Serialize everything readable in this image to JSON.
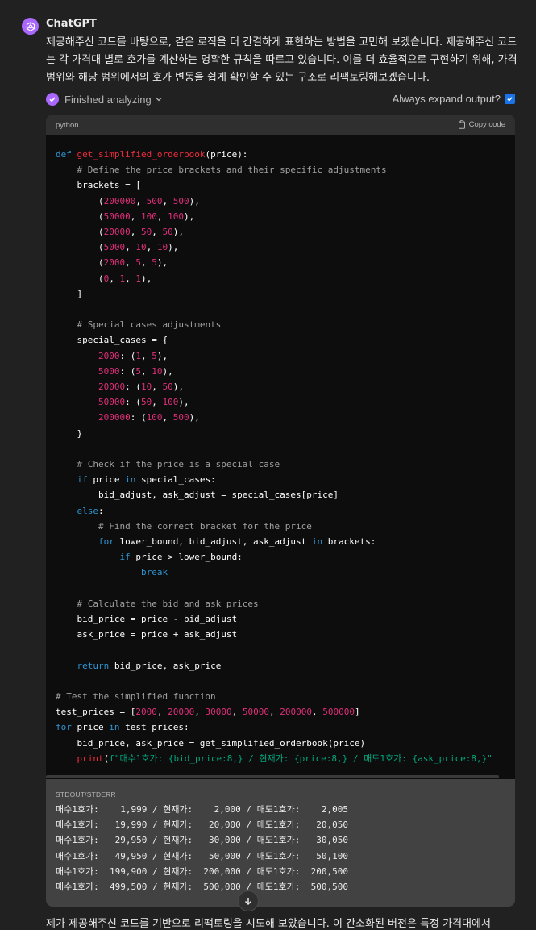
{
  "message": {
    "author": "ChatGPT",
    "intro": "제공해주신 코드를 바탕으로, 같은 로직을 더 간결하게 표현하는 방법을 고민해 보겠습니다. 제공해주신 코드는 각 가격대 별로 호가를 계산하는 명확한 규칙을 따르고 있습니다. 이를 더 효율적으로 구현하기 위해, 가격 범위와 해당 범위에서의 호가 변동을 쉽게 확인할 수 있는 구조로 리팩토링해보겠습니다.",
    "tail": "제가 제공해주신 코드를 기반으로 리팩토링을 시도해 보았습니다. 이 간소화된 버전은 특정 가격대에서"
  },
  "analysis": {
    "status": "Finished analyzing",
    "expand_label": "Always expand output?"
  },
  "code_block": {
    "language": "python",
    "copy_label": "Copy code",
    "lines": [
      {
        "t": [
          [
            "kw",
            "def "
          ],
          [
            "fn",
            "get_simplified_orderbook"
          ],
          [
            "",
            "(price):"
          ]
        ]
      },
      {
        "t": [
          [
            "",
            "    "
          ],
          [
            "cm",
            "# Define the price brackets and their specific adjustments"
          ]
        ]
      },
      {
        "t": [
          [
            "",
            "    brackets = ["
          ]
        ]
      },
      {
        "t": [
          [
            "",
            "        ("
          ],
          [
            "num",
            "200000"
          ],
          [
            "",
            ", "
          ],
          [
            "num",
            "500"
          ],
          [
            "",
            ", "
          ],
          [
            "num",
            "500"
          ],
          [
            "",
            "),"
          ]
        ]
      },
      {
        "t": [
          [
            "",
            "        ("
          ],
          [
            "num",
            "50000"
          ],
          [
            "",
            ", "
          ],
          [
            "num",
            "100"
          ],
          [
            "",
            ", "
          ],
          [
            "num",
            "100"
          ],
          [
            "",
            "),"
          ]
        ]
      },
      {
        "t": [
          [
            "",
            "        ("
          ],
          [
            "num",
            "20000"
          ],
          [
            "",
            ", "
          ],
          [
            "num",
            "50"
          ],
          [
            "",
            ", "
          ],
          [
            "num",
            "50"
          ],
          [
            "",
            "),"
          ]
        ]
      },
      {
        "t": [
          [
            "",
            "        ("
          ],
          [
            "num",
            "5000"
          ],
          [
            "",
            ", "
          ],
          [
            "num",
            "10"
          ],
          [
            "",
            ", "
          ],
          [
            "num",
            "10"
          ],
          [
            "",
            "),"
          ]
        ]
      },
      {
        "t": [
          [
            "",
            "        ("
          ],
          [
            "num",
            "2000"
          ],
          [
            "",
            ", "
          ],
          [
            "num",
            "5"
          ],
          [
            "",
            ", "
          ],
          [
            "num",
            "5"
          ],
          [
            "",
            "),"
          ]
        ]
      },
      {
        "t": [
          [
            "",
            "        ("
          ],
          [
            "num",
            "0"
          ],
          [
            "",
            ", "
          ],
          [
            "num",
            "1"
          ],
          [
            "",
            ", "
          ],
          [
            "num",
            "1"
          ],
          [
            "",
            "),"
          ]
        ]
      },
      {
        "t": [
          [
            "",
            "    ]"
          ]
        ]
      },
      {
        "t": []
      },
      {
        "t": [
          [
            "",
            "    "
          ],
          [
            "cm",
            "# Special cases adjustments"
          ]
        ]
      },
      {
        "t": [
          [
            "",
            "    special_cases = {"
          ]
        ]
      },
      {
        "t": [
          [
            "",
            "        "
          ],
          [
            "num",
            "2000"
          ],
          [
            "",
            ": ("
          ],
          [
            "num",
            "1"
          ],
          [
            "",
            ", "
          ],
          [
            "num",
            "5"
          ],
          [
            "",
            "),"
          ]
        ]
      },
      {
        "t": [
          [
            "",
            "        "
          ],
          [
            "num",
            "5000"
          ],
          [
            "",
            ": ("
          ],
          [
            "num",
            "5"
          ],
          [
            "",
            ", "
          ],
          [
            "num",
            "10"
          ],
          [
            "",
            "),"
          ]
        ]
      },
      {
        "t": [
          [
            "",
            "        "
          ],
          [
            "num",
            "20000"
          ],
          [
            "",
            ": ("
          ],
          [
            "num",
            "10"
          ],
          [
            "",
            ", "
          ],
          [
            "num",
            "50"
          ],
          [
            "",
            "),"
          ]
        ]
      },
      {
        "t": [
          [
            "",
            "        "
          ],
          [
            "num",
            "50000"
          ],
          [
            "",
            ": ("
          ],
          [
            "num",
            "50"
          ],
          [
            "",
            ", "
          ],
          [
            "num",
            "100"
          ],
          [
            "",
            "),"
          ]
        ]
      },
      {
        "t": [
          [
            "",
            "        "
          ],
          [
            "num",
            "200000"
          ],
          [
            "",
            ": ("
          ],
          [
            "num",
            "100"
          ],
          [
            "",
            ", "
          ],
          [
            "num",
            "500"
          ],
          [
            "",
            "),"
          ]
        ]
      },
      {
        "t": [
          [
            "",
            "    }"
          ]
        ]
      },
      {
        "t": []
      },
      {
        "t": [
          [
            "",
            "    "
          ],
          [
            "cm",
            "# Check if the price is a special case"
          ]
        ]
      },
      {
        "t": [
          [
            "",
            "    "
          ],
          [
            "kw",
            "if"
          ],
          [
            "",
            " price "
          ],
          [
            "kw",
            "in"
          ],
          [
            "",
            " special_cases:"
          ]
        ]
      },
      {
        "t": [
          [
            "",
            "        bid_adjust, ask_adjust = special_cases[price]"
          ]
        ]
      },
      {
        "t": [
          [
            "",
            "    "
          ],
          [
            "kw",
            "else"
          ],
          [
            "",
            ":"
          ]
        ]
      },
      {
        "t": [
          [
            "",
            "        "
          ],
          [
            "cm",
            "# Find the correct bracket for the price"
          ]
        ]
      },
      {
        "t": [
          [
            "",
            "        "
          ],
          [
            "kw",
            "for"
          ],
          [
            "",
            " lower_bound, bid_adjust, ask_adjust "
          ],
          [
            "kw",
            "in"
          ],
          [
            "",
            " brackets:"
          ]
        ]
      },
      {
        "t": [
          [
            "",
            "            "
          ],
          [
            "kw",
            "if"
          ],
          [
            "",
            " price > lower_bound:"
          ]
        ]
      },
      {
        "t": [
          [
            "",
            "                "
          ],
          [
            "kw",
            "break"
          ]
        ]
      },
      {
        "t": []
      },
      {
        "t": [
          [
            "",
            "    "
          ],
          [
            "cm",
            "# Calculate the bid and ask prices"
          ]
        ]
      },
      {
        "t": [
          [
            "",
            "    bid_price = price - bid_adjust"
          ]
        ]
      },
      {
        "t": [
          [
            "",
            "    ask_price = price + ask_adjust"
          ]
        ]
      },
      {
        "t": []
      },
      {
        "t": [
          [
            "",
            "    "
          ],
          [
            "kw",
            "return"
          ],
          [
            "",
            " bid_price, ask_price"
          ]
        ]
      },
      {
        "t": []
      },
      {
        "t": [
          [
            "cm",
            "# Test the simplified function"
          ]
        ]
      },
      {
        "t": [
          [
            "",
            "test_prices = ["
          ],
          [
            "num",
            "2000"
          ],
          [
            "",
            ", "
          ],
          [
            "num",
            "20000"
          ],
          [
            "",
            ", "
          ],
          [
            "num",
            "30000"
          ],
          [
            "",
            ", "
          ],
          [
            "num",
            "50000"
          ],
          [
            "",
            ", "
          ],
          [
            "num",
            "200000"
          ],
          [
            "",
            ", "
          ],
          [
            "num",
            "500000"
          ],
          [
            "",
            "]"
          ]
        ]
      },
      {
        "t": [
          [
            "kw",
            "for"
          ],
          [
            "",
            " price "
          ],
          [
            "kw",
            "in"
          ],
          [
            "",
            " test_prices:"
          ]
        ]
      },
      {
        "t": [
          [
            "",
            "    bid_price, ask_price = get_simplified_orderbook(price)"
          ]
        ]
      },
      {
        "t": [
          [
            "",
            "    "
          ],
          [
            "fn",
            "print"
          ],
          [
            "",
            "("
          ],
          [
            "str",
            "f\"매수1호가: {bid_price:8,} / 현재가: {price:8,} / 매도1호가: {ask_price:8,}\""
          ]
        ]
      }
    ]
  },
  "stdout": {
    "label": "STDOUT/STDERR",
    "lines": [
      "매수1호가:    1,999 / 현재가:    2,000 / 매도1호가:    2,005",
      "매수1호가:   19,990 / 현재가:   20,000 / 매도1호가:   20,050",
      "매수1호가:   29,950 / 현재가:   30,000 / 매도1호가:   30,050",
      "매수1호가:   49,950 / 현재가:   50,000 / 매도1호가:   50,100",
      "매수1호가:  199,900 / 현재가:  200,000 / 매도1호가:  200,500",
      "매수1호가:  499,500 / 현재가:  500,000 / 매도1호가:  500,500"
    ]
  },
  "colors": {
    "background": "#212121",
    "accent": "#ab68ff",
    "keyword": "#2e95d3",
    "function": "#f22c3d",
    "number": "#df3079",
    "string": "#00a67d",
    "comment": "#a0a0a0"
  }
}
